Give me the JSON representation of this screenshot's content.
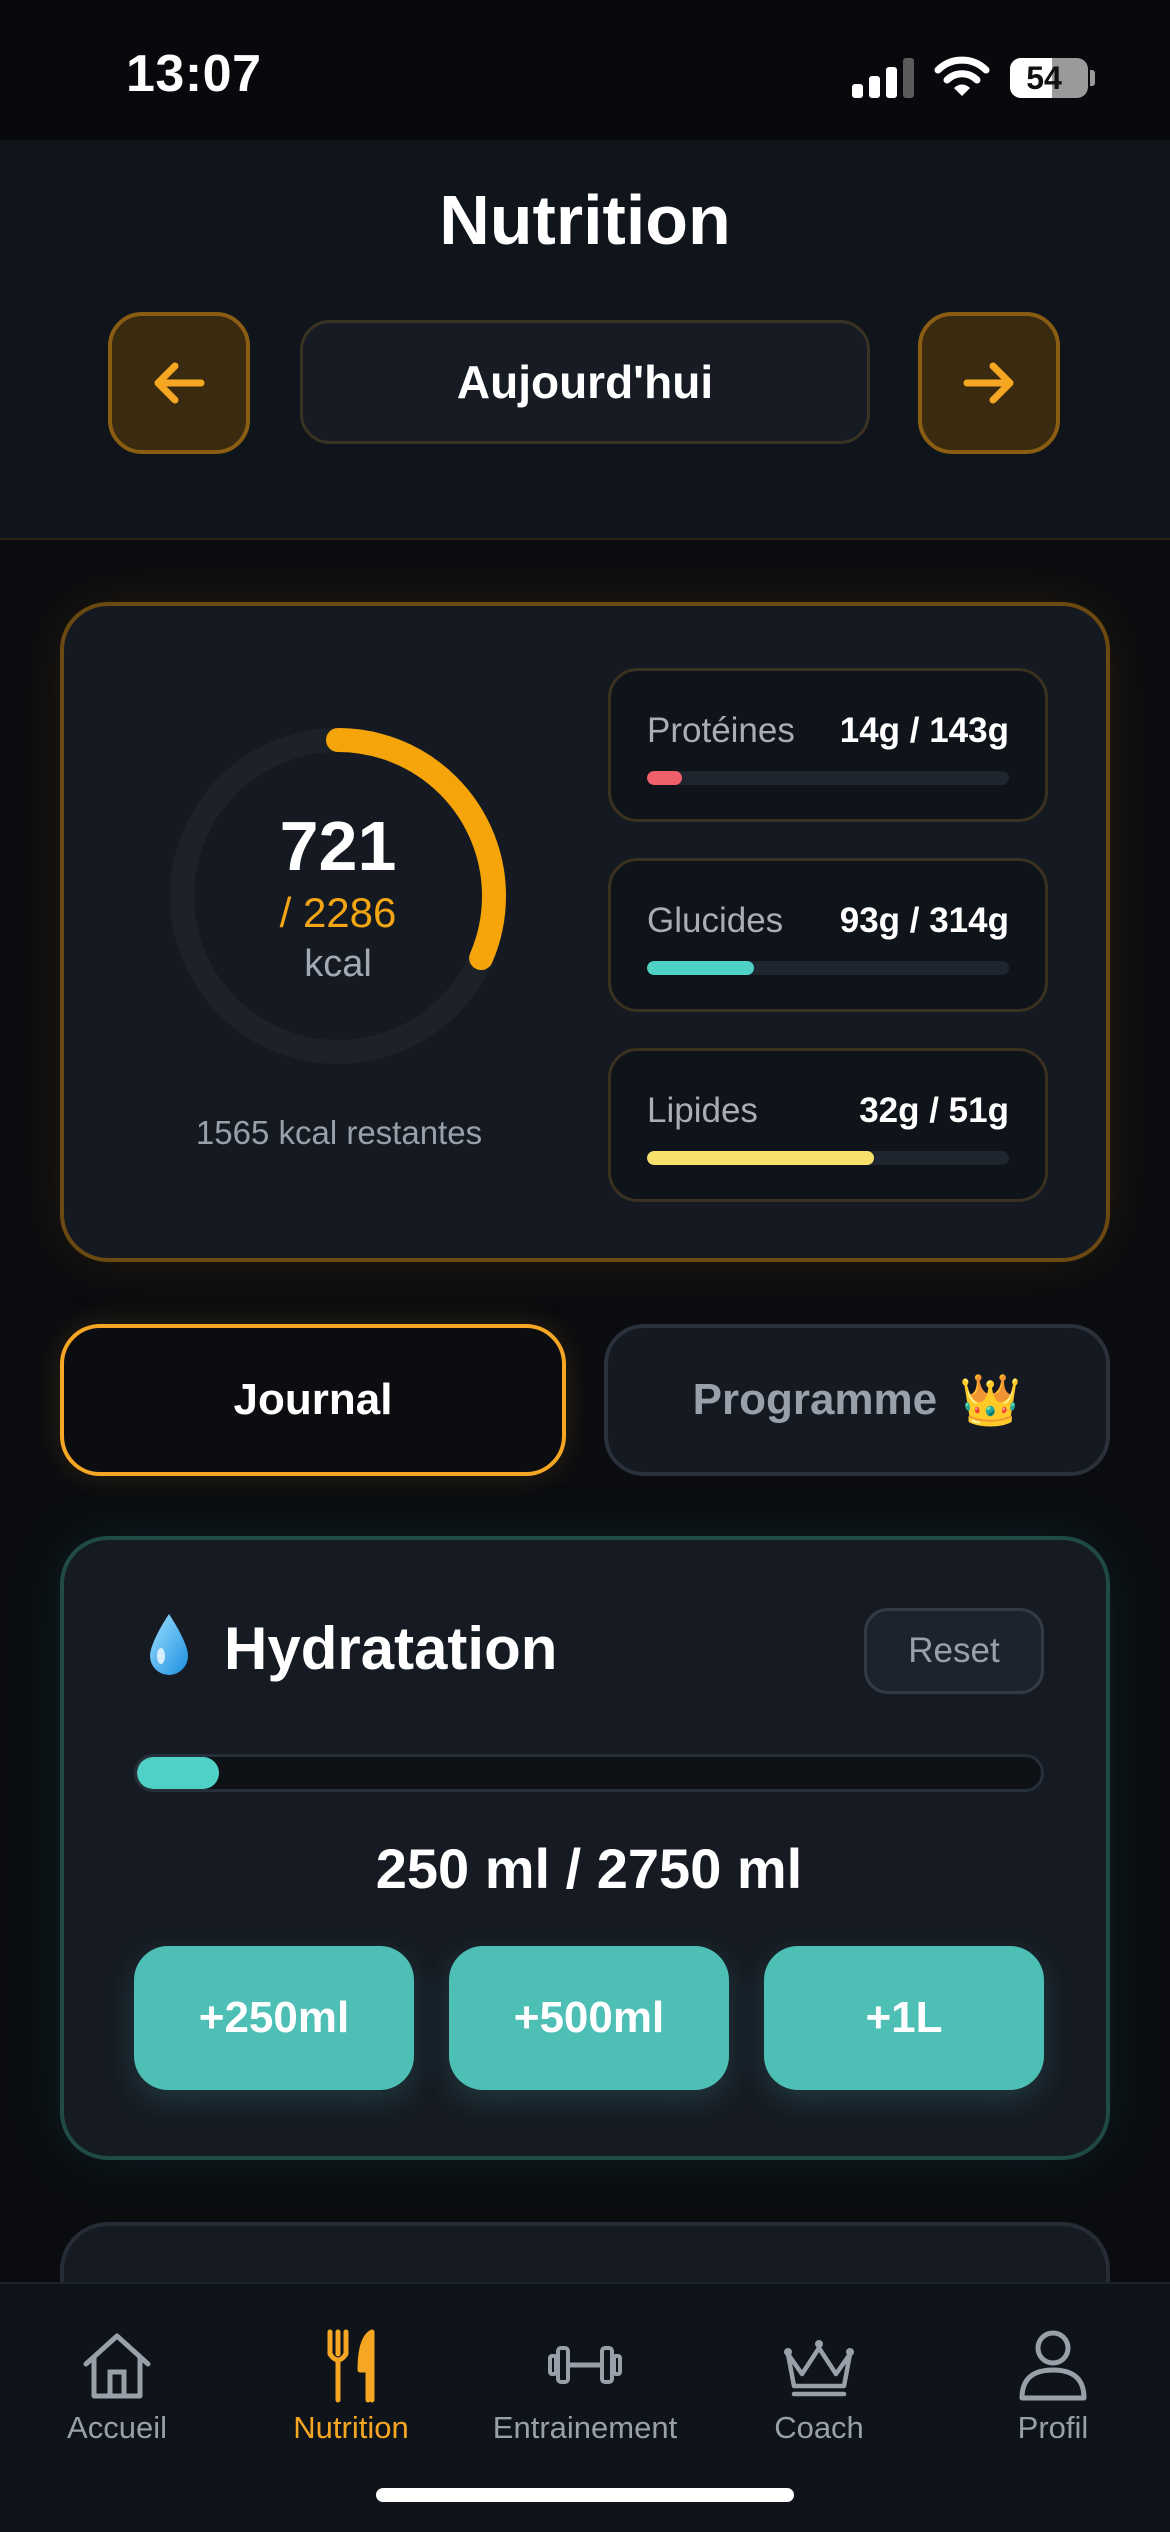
{
  "status_bar": {
    "time": "13:07",
    "battery": "54",
    "battery_level": 0.54
  },
  "header": {
    "title": "Nutrition",
    "date_label": "Aujourd'hui",
    "prev_icon": "arrow-left-icon",
    "next_icon": "arrow-right-icon"
  },
  "summary": {
    "calories": "721",
    "goal": "/ 2286",
    "unit": "kcal",
    "progress": 0.315,
    "remaining": "1565 kcal restantes",
    "macros": [
      {
        "name": "Protéines",
        "value": "14g / 143g",
        "progress": 0.098,
        "color": "#f0606b"
      },
      {
        "name": "Glucides",
        "value": "93g / 314g",
        "progress": 0.296,
        "color": "#4fd1c5"
      },
      {
        "name": "Lipides",
        "value": "32g / 51g",
        "progress": 0.627,
        "color": "#f7e06c"
      }
    ]
  },
  "tabs": {
    "journal": "Journal",
    "programme": "Programme",
    "programme_icon": "👑"
  },
  "hydration": {
    "icon": "water-drop-icon",
    "title": "Hydratation",
    "reset": "Reset",
    "amount": "250 ml / 2750 ml",
    "progress": 0.091,
    "buttons": [
      "+250ml",
      "+500ml",
      "+1L"
    ]
  },
  "nav": [
    {
      "label": "Accueil",
      "icon": "home-icon"
    },
    {
      "label": "Nutrition",
      "icon": "fork-knife-icon"
    },
    {
      "label": "Entrainement",
      "icon": "dumbbell-icon"
    },
    {
      "label": "Coach",
      "icon": "crown-icon"
    },
    {
      "label": "Profil",
      "icon": "person-icon"
    }
  ],
  "colors": {
    "accent": "#f5a623",
    "teal": "#4fd1c5",
    "background": "#0a0c10"
  }
}
